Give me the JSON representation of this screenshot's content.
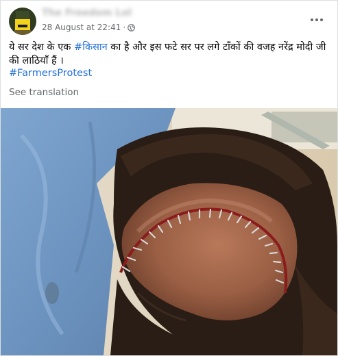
{
  "post": {
    "author_name": "The Freedom Lobby",
    "timestamp": "28 August at 22:41",
    "separator": "·",
    "text_before": "ये सर देश के एक ",
    "hashtag_1": "#किसान",
    "text_after": " का है और इस फटे सर पर लगे टाँकों की वजह नरेंद्र मोदी जी की लाठियाँ हैं ।",
    "hashtag_2": "#FarmersProtest",
    "see_translation": "See translation",
    "privacy_icon": "globe-icon",
    "menu_icon": "more-options-icon"
  },
  "colors": {
    "link": "#216fdb",
    "secondary_text": "#65676b",
    "border": "#dddfe2"
  }
}
